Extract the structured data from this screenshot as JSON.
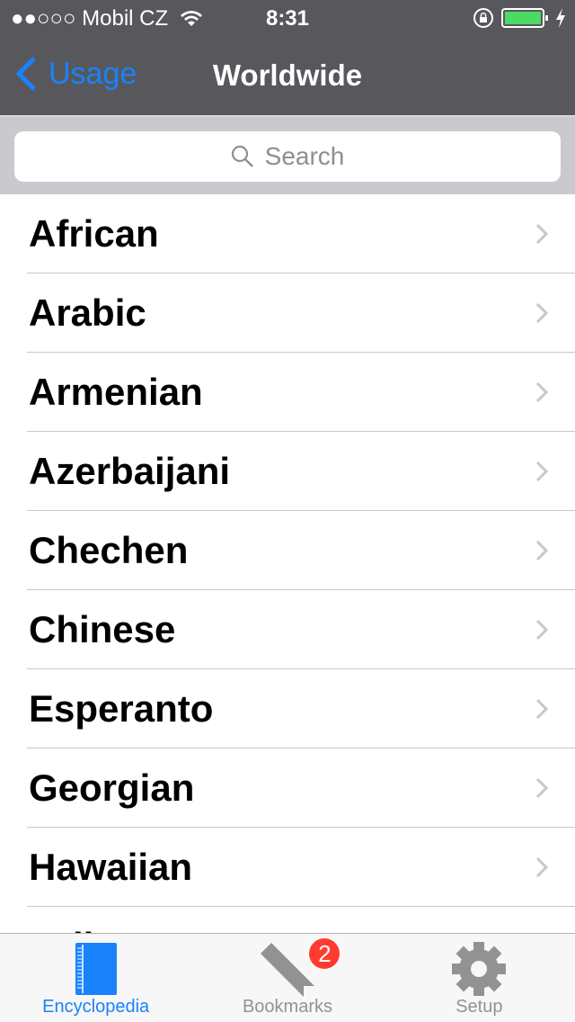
{
  "status_bar": {
    "carrier": "●●○○○ Mobil CZ",
    "time": "8:31",
    "battery_percent": 100,
    "charging": true
  },
  "nav": {
    "back_label": "Usage",
    "title": "Worldwide"
  },
  "search": {
    "placeholder": "Search"
  },
  "list": {
    "items": [
      {
        "label": "African"
      },
      {
        "label": "Arabic"
      },
      {
        "label": "Armenian"
      },
      {
        "label": "Azerbaijani"
      },
      {
        "label": "Chechen"
      },
      {
        "label": "Chinese"
      },
      {
        "label": "Esperanto"
      },
      {
        "label": "Georgian"
      },
      {
        "label": "Hawaiian"
      },
      {
        "label": "Italian"
      }
    ]
  },
  "tabbar": {
    "tabs": [
      {
        "label": "Encyclopedia",
        "icon": "book-icon",
        "active": true
      },
      {
        "label": "Bookmarks",
        "icon": "bookmark-icon",
        "badge": "2"
      },
      {
        "label": "Setup",
        "icon": "gear-icon"
      }
    ]
  },
  "colors": {
    "accent": "#1a82fb",
    "nav_bg": "#58585c",
    "badge": "#ff3b30"
  }
}
